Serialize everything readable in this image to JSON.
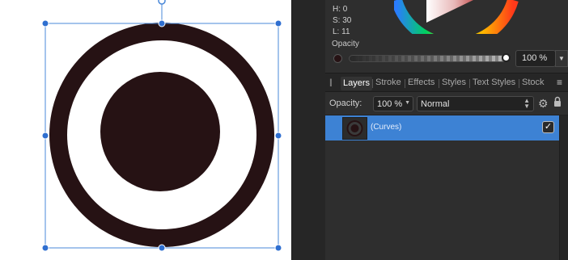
{
  "color_panel": {
    "h": "H: 0",
    "s": "S: 30",
    "l": "L: 11",
    "opacity_label": "Opacity",
    "opacity_value": "100 %",
    "opacity_fraction": 1.0,
    "current_color": "#261214"
  },
  "tabs": [
    {
      "label": "Layers",
      "active": true
    },
    {
      "label": "Stroke",
      "active": false
    },
    {
      "label": "Effects",
      "active": false
    },
    {
      "label": "Styles",
      "active": false
    },
    {
      "label": "Text Styles",
      "active": false
    },
    {
      "label": "Stock",
      "active": false
    }
  ],
  "layer_controls": {
    "opacity_label": "Opacity:",
    "opacity_value": "100 %",
    "blend_mode": "Normal"
  },
  "layers": [
    {
      "name": "(Curves)",
      "visible": true,
      "selected": true
    }
  ],
  "colors": {
    "shape_fill": "#261214",
    "selection_accent": "#3d82d4",
    "handle": "#2f6fd0"
  }
}
